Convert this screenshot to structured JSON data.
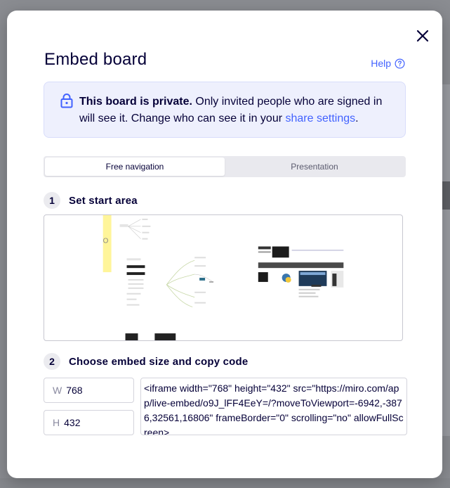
{
  "modal": {
    "title": "Embed board",
    "help_label": "Help",
    "private_notice": {
      "bold": "This board is private.",
      "text": "Only invited people who are signed in will see it. Change who can see it in your",
      "link": "share settings",
      "trailing": "."
    },
    "tabs": [
      {
        "label": "Free navigation",
        "active": true
      },
      {
        "label": "Presentation",
        "active": false
      }
    ],
    "step1": {
      "number": "1",
      "label": "Set start area"
    },
    "step2": {
      "number": "2",
      "label": "Choose embed size and copy code"
    },
    "width": {
      "prefix": "W",
      "value": "768"
    },
    "height": {
      "prefix": "H",
      "value": "432"
    },
    "embed_code": "<iframe width=\"768\" height=\"432\" src=\"https://miro.com/app/live-embed/o9J_lFF4EeY=/?moveToViewport=-6942,-3876,32561,16806\" frameBorder=\"0\" scrolling=\"no\" allowFullScreen>"
  },
  "colors": {
    "accent": "#4262ff",
    "text": "#050038",
    "notice_bg": "#eef0fd"
  },
  "icons": {
    "close": "close-icon",
    "help": "question-circle-icon",
    "lock": "lock-icon"
  }
}
